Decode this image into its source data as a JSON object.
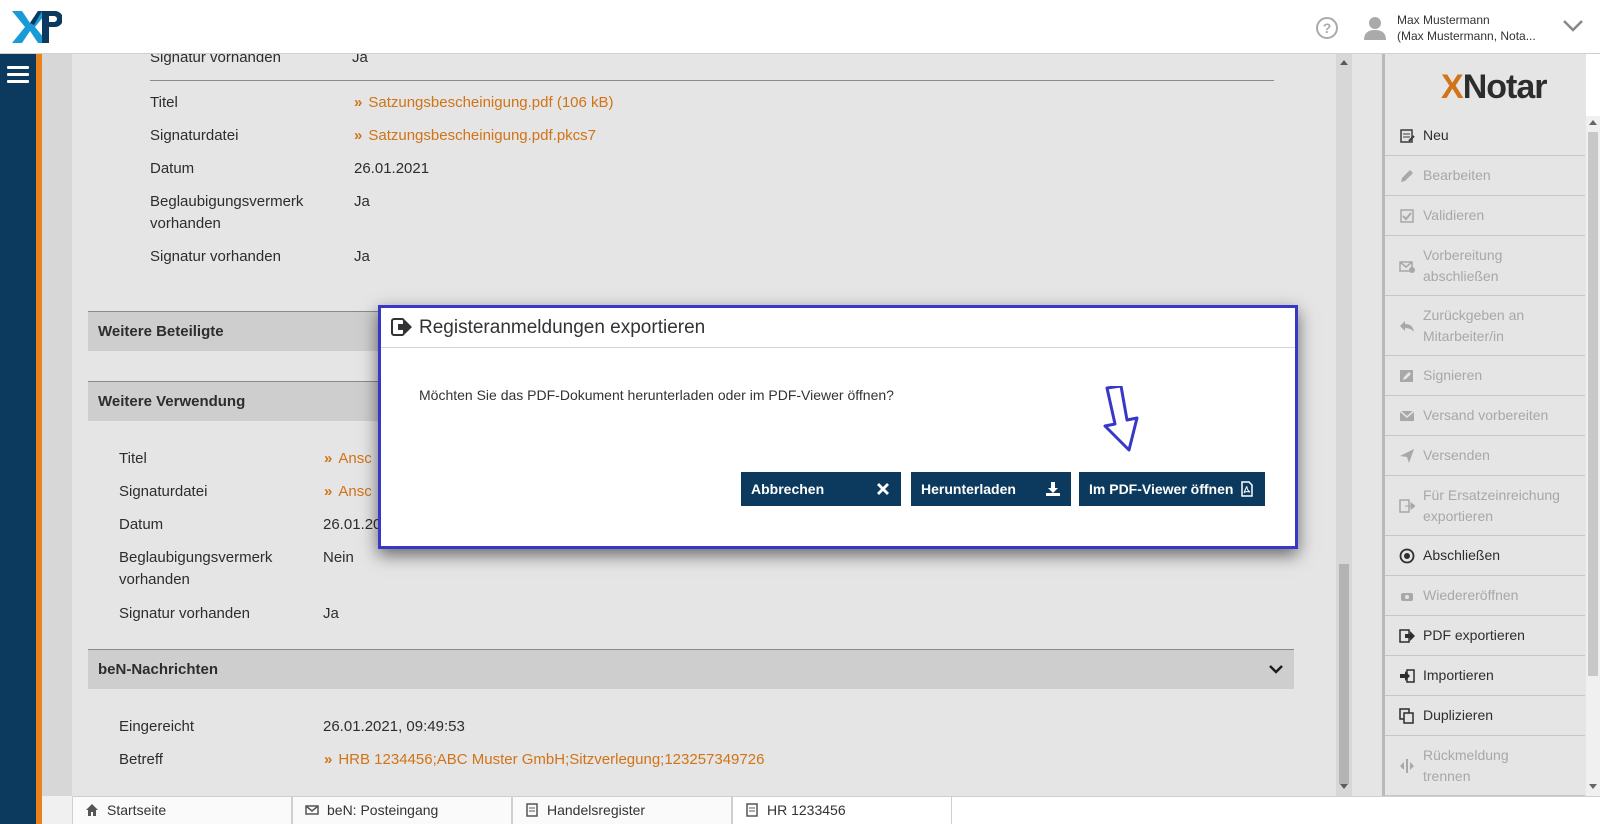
{
  "header": {
    "user_name": "Max Mustermann",
    "user_sub": "(Max Mustermann, Nota..."
  },
  "upper": {
    "signatur_label_top": "Signatur vorhanden",
    "signatur_value_top": "Ja",
    "titel_label": "Titel",
    "titel_link": "Satzungsbescheinigung.pdf (106 kB)",
    "signaturdatei_label": "Signaturdatei",
    "signaturdatei_link": "Satzungsbescheinigung.pdf.pkcs7",
    "datum_label": "Datum",
    "datum_value": "26.01.2021",
    "beglaubigung_label_1": "Beglaubigungsvermerk",
    "beglaubigung_label_2": "vorhanden",
    "beglaubigung_value": "Ja",
    "signatur_label": "Signatur vorhanden",
    "signatur_value": "Ja"
  },
  "sections": {
    "weitere_beteiligte": "Weitere Beteiligte",
    "weitere_verwendung": "Weitere Verwendung",
    "ben_nachrichten": "beN-Nachrichten"
  },
  "verwendung": {
    "titel_label": "Titel",
    "titel_link": "Ansc",
    "signaturdatei_label": "Signaturdatei",
    "signaturdatei_link": "Ansc",
    "datum_label": "Datum",
    "datum_value": "26.01.20",
    "beglaubigung_label_1": "Beglaubigungsvermerk",
    "beglaubigung_label_2": "vorhanden",
    "beglaubigung_value": "Nein",
    "signatur_label": "Signatur vorhanden",
    "signatur_value": "Ja"
  },
  "ben": {
    "eingereicht_label": "Eingereicht",
    "eingereicht_value": "26.01.2021, 09:49:53",
    "betreff_label": "Betreff",
    "betreff_link": "HRB 1234456;ABC Muster GmbH;Sitzverlegung;123257349726"
  },
  "sidebar": {
    "brand_x": "X",
    "brand_rest": "Notar",
    "actions": [
      {
        "label": "Neu",
        "icon": "new-document-icon",
        "enabled": true
      },
      {
        "label": "Bearbeiten",
        "icon": "pencil-icon",
        "enabled": false
      },
      {
        "label": "Validieren",
        "icon": "check-square-icon",
        "enabled": false
      },
      {
        "label_1": "Vorbereitung",
        "label_2": "abschließen",
        "icon": "envelope-check-icon",
        "enabled": false
      },
      {
        "label_1": "Zurückgeben an",
        "label_2": "Mitarbeiter/in",
        "icon": "reply-icon",
        "enabled": false
      },
      {
        "label": "Signieren",
        "icon": "pen-square-icon",
        "enabled": false
      },
      {
        "label": "Versand vorbereiten",
        "icon": "envelope-icon",
        "enabled": false
      },
      {
        "label": "Versenden",
        "icon": "paper-plane-icon",
        "enabled": false
      },
      {
        "label_1": "Für Ersatzeinreichung",
        "label_2": "exportieren",
        "icon": "export-icon",
        "enabled": false
      },
      {
        "label": "Abschließen",
        "icon": "target-icon",
        "enabled": true
      },
      {
        "label": "Wiedereröffnen",
        "icon": "reopen-icon",
        "enabled": false
      },
      {
        "label": "PDF exportieren",
        "icon": "export-icon",
        "enabled": true
      },
      {
        "label": "Importieren",
        "icon": "import-icon",
        "enabled": true
      },
      {
        "label": "Duplizieren",
        "icon": "copy-icon",
        "enabled": true
      },
      {
        "label_1": "Rückmeldung",
        "label_2": "trennen",
        "icon": "split-icon",
        "enabled": false
      }
    ]
  },
  "dialog": {
    "title": "Registeranmeldungen exportieren",
    "message": "Möchten Sie das PDF-Dokument herunterladen oder im PDF-Viewer öffnen?",
    "cancel_label": "Abbrechen",
    "download_label": "Herunterladen",
    "viewer_label": "Im PDF-Viewer öffnen"
  },
  "tabs": [
    {
      "label": "Startseite",
      "icon": "home-icon"
    },
    {
      "label": "beN: Posteingang",
      "icon": "envelope-icon"
    },
    {
      "label": "Handelsregister",
      "icon": "document-icon"
    },
    {
      "label": "HR 1233456",
      "icon": "document-icon"
    }
  ],
  "colors": {
    "navy": "#0c3a5e",
    "orange": "#e8821a",
    "dialog_border": "#3838c8"
  }
}
